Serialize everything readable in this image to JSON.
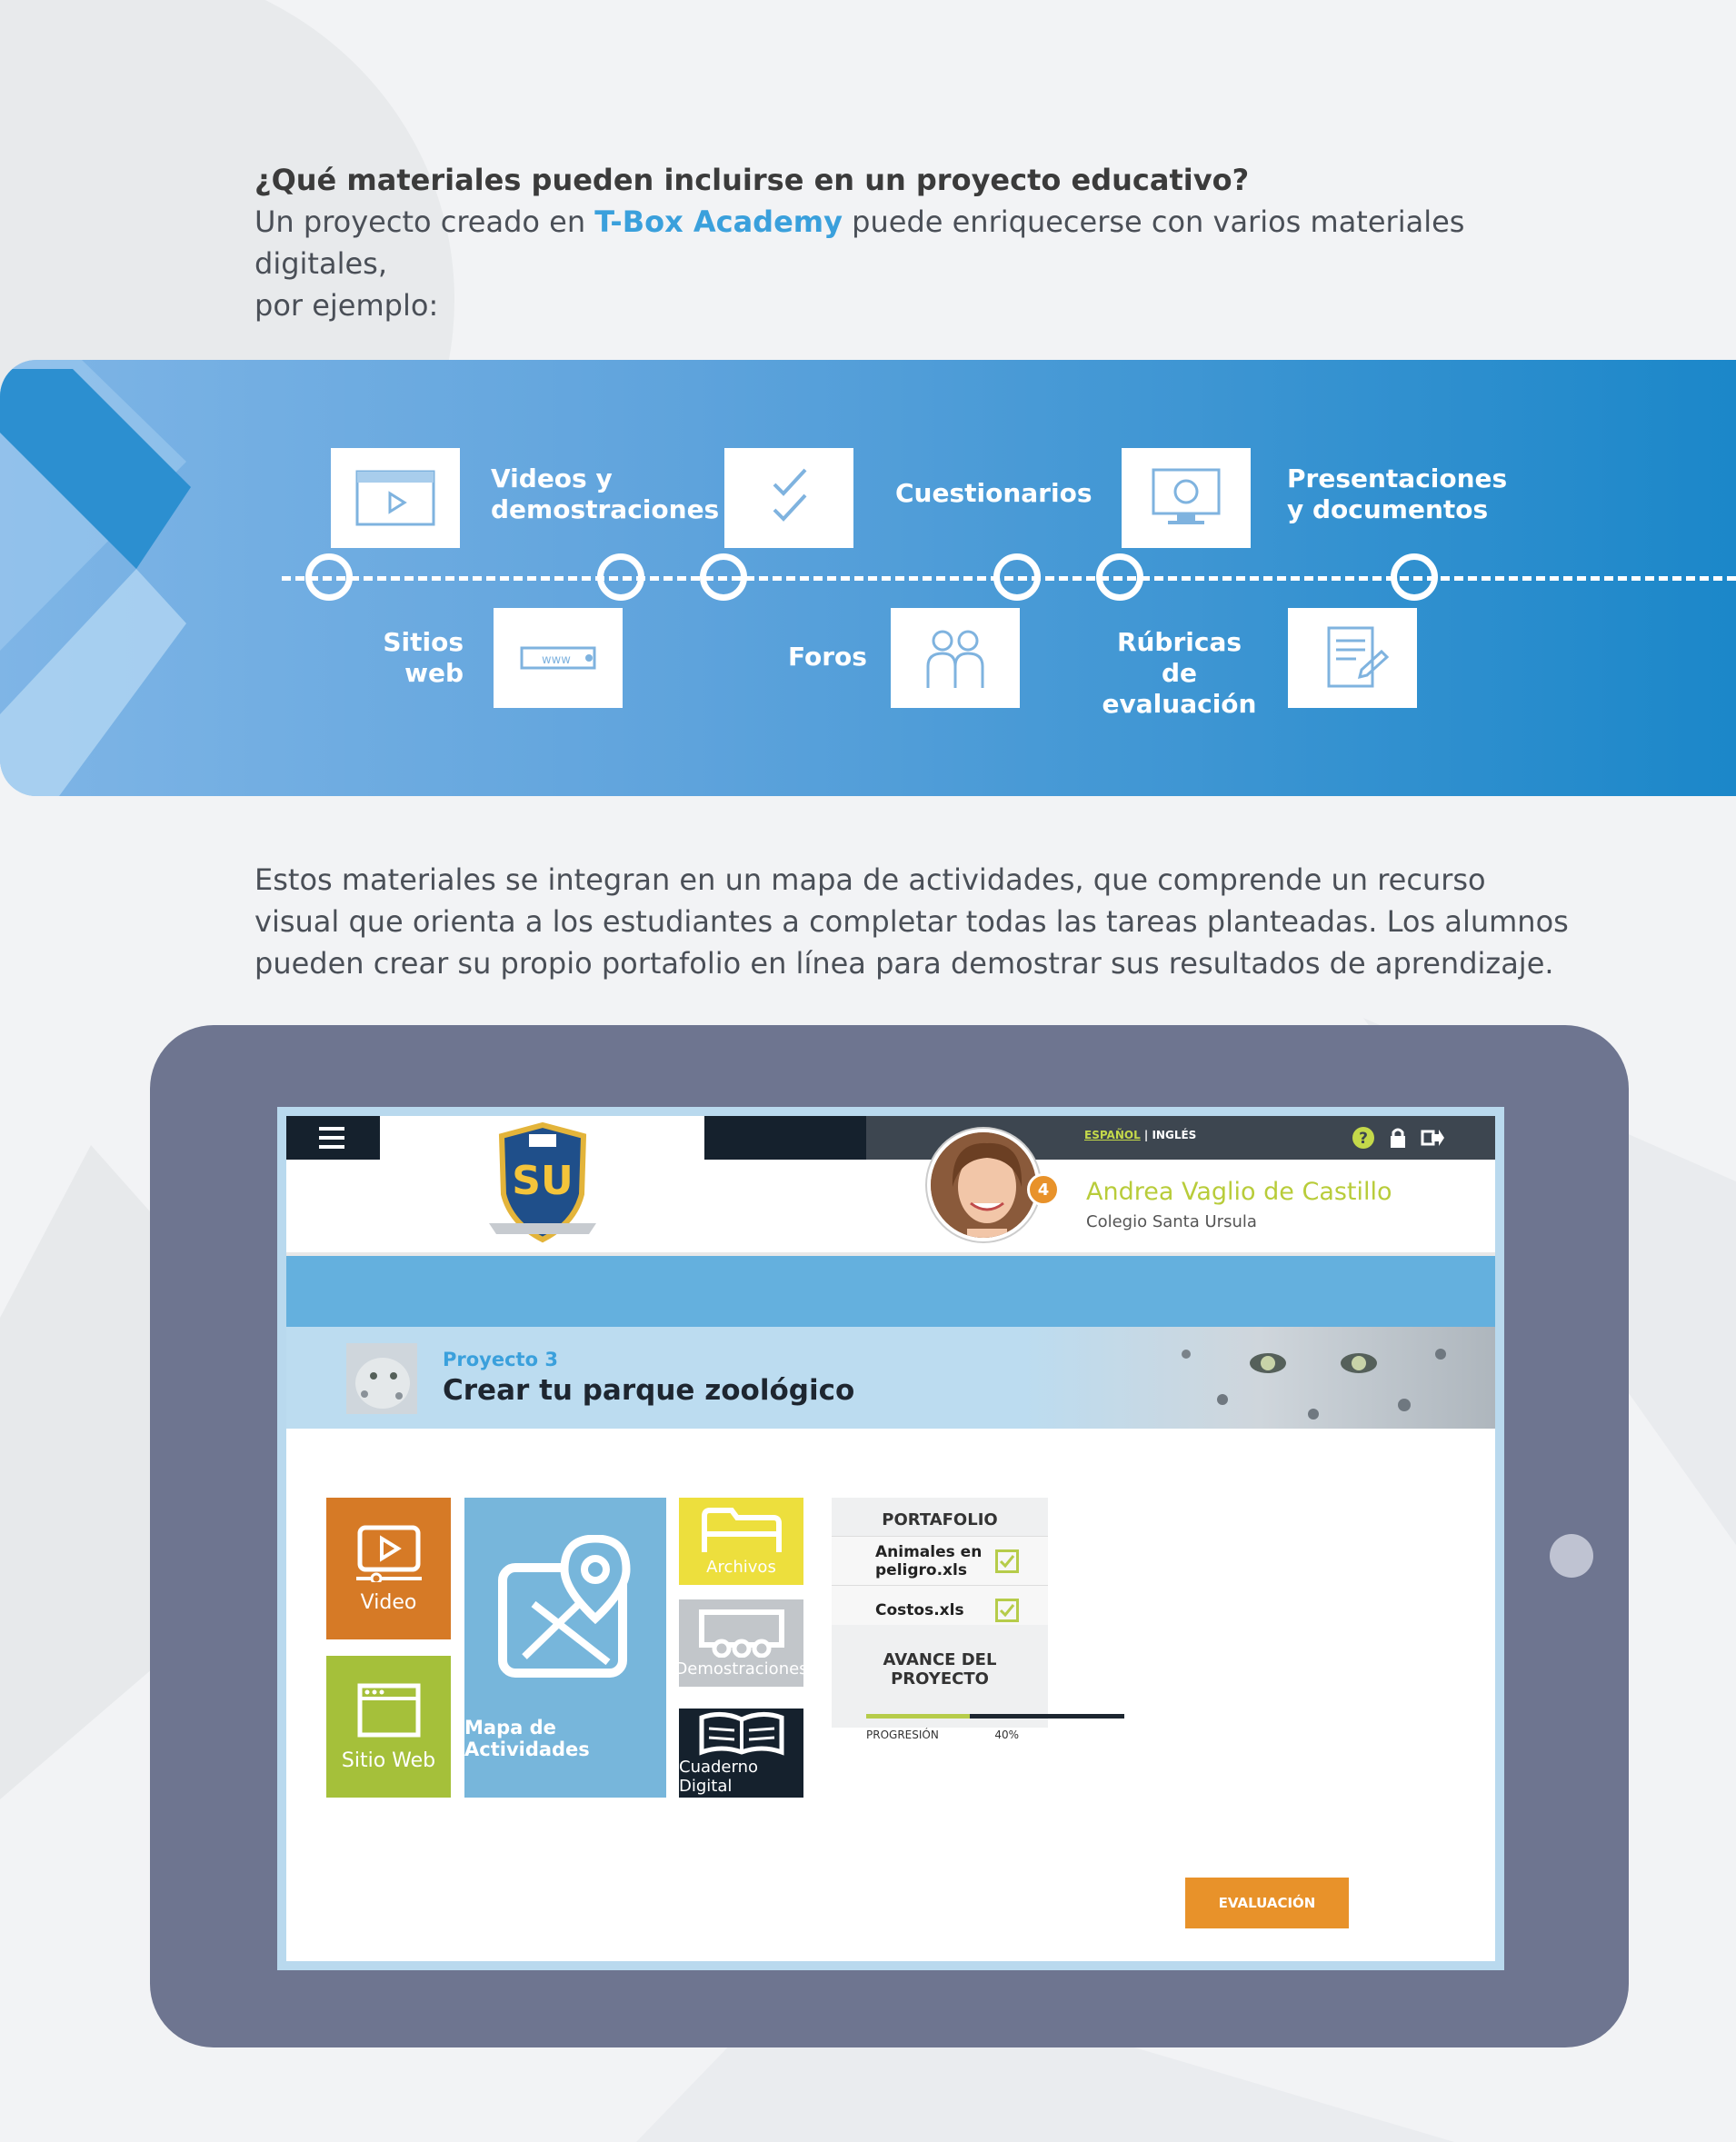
{
  "intro": {
    "question": "¿Qué materiales pueden incluirse en un proyecto educativo?",
    "line1_pre": "Un proyecto creado en ",
    "brand": "T-Box Academy",
    "line1_post": " puede enriquecerse con varios materiales digitales,",
    "line2": "por ejemplo:"
  },
  "materials": {
    "videos": "Videos y demostraciones",
    "cuestionarios": "Cuestionarios",
    "presentaciones": "Presentaciones y documentos",
    "sitios": "Sitios web",
    "foros": "Foros",
    "rubricas": "Rúbricas de evaluación",
    "www": "www"
  },
  "paragraph": "Estos materiales se integran en un mapa de actividades, que comprende un recurso visual que orienta a los estudiantes a completar todas las tareas planteadas. Los alumnos pueden crear su propio portafolio en línea para demostrar sus resultados de aprendizaje.",
  "app": {
    "logo_text": "SU",
    "lang_es": "ESPAÑOL",
    "lang_sep": " | ",
    "lang_en": "INGLÉS",
    "user_name": "Andrea Vaglio de Castillo",
    "school": "Colegio Santa Ursula",
    "notifications": "4",
    "project_number": "Proyecto 3",
    "project_title": "Crear tu parque zoológico",
    "tiles": {
      "video": "Video",
      "sitio": "Sitio Web",
      "mapa": "Mapa de Actividades",
      "archivos": "Archivos",
      "demos": "Demostraciones",
      "cuaderno": "Cuaderno Digital"
    },
    "portfolio": {
      "title": "PORTAFOLIO",
      "items": [
        "Animales en peligro.xls",
        "Costos.xls"
      ]
    },
    "progress": {
      "title": "AVANCE DEL PROYECTO",
      "label": "PROGRESIÓN",
      "value_text": "40%",
      "fraction": 0.4
    },
    "eval_button": "EVALUACIÓN"
  },
  "colors": {
    "accent_blue": "#3aa0dc",
    "orange": "#d67a26",
    "green": "#a5c03a",
    "yellow": "#eddf3d",
    "grey": "#c2c6ca",
    "navy": "#15212d"
  }
}
